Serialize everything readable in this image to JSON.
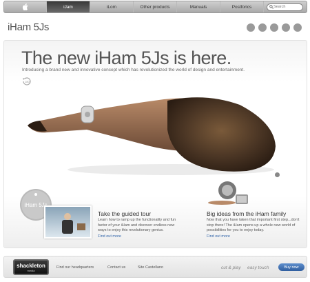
{
  "nav": {
    "items": [
      {
        "label": "iJam",
        "active": true
      },
      {
        "label": "iLom",
        "active": false
      },
      {
        "label": "Other products",
        "active": false
      },
      {
        "label": "Manuals",
        "active": false
      },
      {
        "label": "Postforics",
        "active": false
      }
    ],
    "search_placeholder": "Search"
  },
  "header": {
    "product_title": "iHam 5Js",
    "icons": [
      "circle-icon-1",
      "circle-icon-2",
      "circle-icon-3",
      "circle-icon-4",
      "circle-icon-5"
    ]
  },
  "hero": {
    "headline": "The new iHam 5Js is here.",
    "intro": "Introducing a brand new and innovative concept which has revolutionized the world of design and entertainment.",
    "rotate_label": "180°"
  },
  "promos": {
    "cd_label": "iHam 5Js",
    "tour": {
      "title": "Take the guided tour",
      "body": "Learn how to ramp up the functionality and fun factor of your iHam and discover endless new ways to enjoy this revolutionary genius.",
      "link": "Find out more"
    },
    "family": {
      "title": "Big ideas from the iHam family",
      "body": "Now that you have taken that important first step...don't stop there! The iHam opens up a whole new world of possibilities for you to enjoy today.",
      "link": "Find out more"
    }
  },
  "footer": {
    "brand": "shackleton",
    "brand_sub": "media",
    "links": [
      "Find our headquarters",
      "Contact us",
      "Site Castellano"
    ],
    "logos": [
      "cut & play",
      "easy touch"
    ],
    "buy_label": "Buy now"
  },
  "colors": {
    "nav_active": "#4a4a4a",
    "link": "#3366aa",
    "buy_button": "#3a6db0"
  }
}
